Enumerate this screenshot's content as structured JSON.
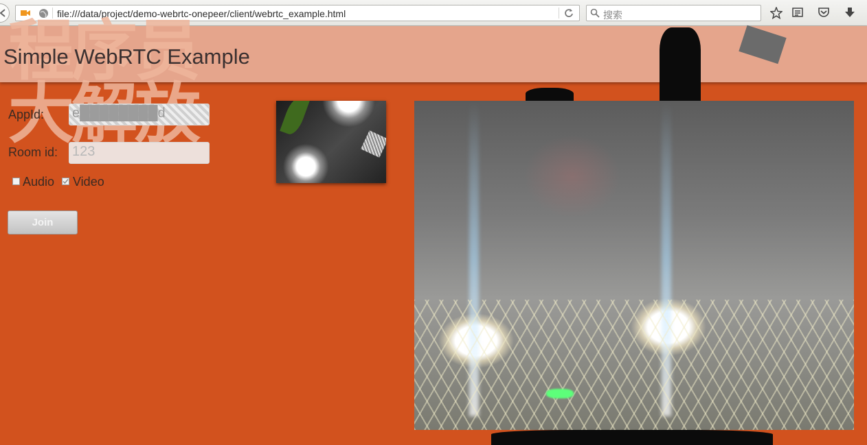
{
  "browser": {
    "url": "file:///data/project/demo-webrtc-onepeer/client/webrtc_example.html",
    "search_placeholder": "搜索",
    "icons": [
      "back-icon",
      "camera-icon",
      "globe-icon",
      "reload-icon",
      "search-icon",
      "bookmark-star-icon",
      "reader-icon",
      "pocket-icon",
      "download-icon"
    ]
  },
  "page": {
    "title": "Simple WebRTC Example",
    "background_text": "程序员大解放",
    "form": {
      "appid_label": "AppId:",
      "appid_value": "e████████d",
      "room_label": "Room id:",
      "room_value": "123",
      "audio_label": "Audio",
      "video_label": "Video",
      "audio_checked": false,
      "video_checked": true,
      "join_label": "Join"
    }
  },
  "colors": {
    "page_bg": "#d2521e",
    "header_bg": "#e5a58c"
  }
}
